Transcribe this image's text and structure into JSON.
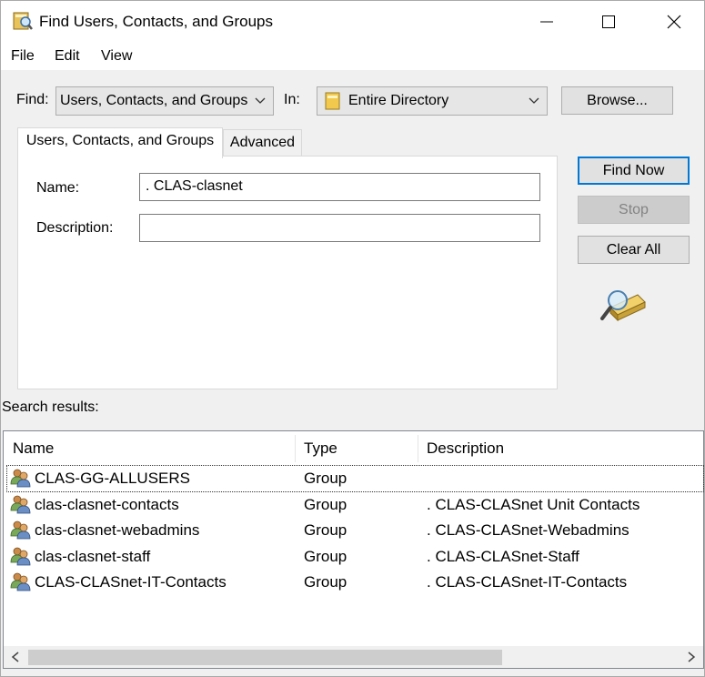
{
  "window": {
    "title": "Find Users, Contacts, and Groups"
  },
  "menu": [
    "File",
    "Edit",
    "View"
  ],
  "find_row": {
    "find_label": "Find:",
    "find_value": "Users, Contacts, and Groups",
    "in_label": "In:",
    "in_value": "Entire Directory",
    "browse_label": "Browse..."
  },
  "tabs": [
    {
      "label": "Users, Contacts, and Groups",
      "active": true
    },
    {
      "label": "Advanced",
      "active": false
    }
  ],
  "form": {
    "name_label": "Name:",
    "name_value": ". CLAS-clasnet",
    "description_label": "Description:",
    "description_value": ""
  },
  "actions": {
    "find_now": "Find Now",
    "stop": "Stop",
    "clear_all": "Clear All"
  },
  "results": {
    "label": "Search results:",
    "columns": [
      "Name",
      "Type",
      "Description"
    ],
    "rows": [
      {
        "name": "CLAS-GG-ALLUSERS",
        "type": "Group",
        "description": ""
      },
      {
        "name": "clas-clasnet-contacts",
        "type": "Group",
        "description": ". CLAS-CLASnet Unit Contacts"
      },
      {
        "name": "clas-clasnet-webadmins",
        "type": "Group",
        "description": ". CLAS-CLASnet-Webadmins"
      },
      {
        "name": "clas-clasnet-staff",
        "type": "Group",
        "description": ". CLAS-CLASnet-Staff"
      },
      {
        "name": "CLAS-CLASnet-IT-Contacts",
        "type": "Group",
        "description": ". CLAS-CLASnet-IT-Contacts"
      }
    ]
  },
  "colors": {
    "accent": "#0078d7",
    "window_bg": "#f0f0f0"
  }
}
